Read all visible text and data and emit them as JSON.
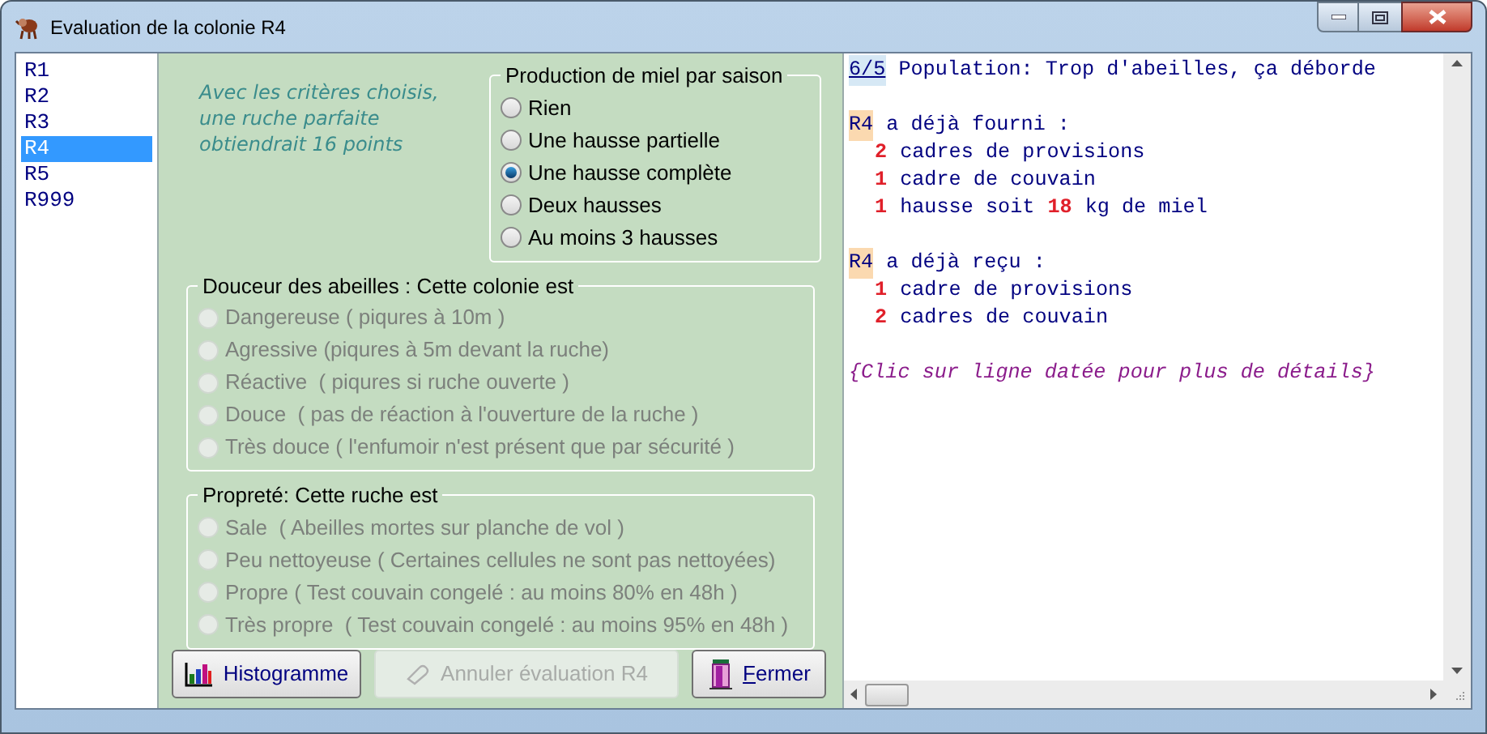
{
  "window": {
    "title": "Evaluation de la colonie R4"
  },
  "hive_list": [
    {
      "label": "R1",
      "selected": false
    },
    {
      "label": "R2",
      "selected": false
    },
    {
      "label": "R3",
      "selected": false
    },
    {
      "label": "R4",
      "selected": true
    },
    {
      "label": "R5",
      "selected": false
    },
    {
      "label": "R999",
      "selected": false
    }
  ],
  "info_text": [
    "Avec les critères choisis,",
    "une ruche parfaite",
    "obtiendrait 16 points"
  ],
  "groups": [
    {
      "title": "Production de miel par saison",
      "disabled": false,
      "options": [
        {
          "label": "Rien",
          "selected": false
        },
        {
          "label": "Une hausse partielle",
          "selected": false
        },
        {
          "label": "Une hausse complète",
          "selected": true
        },
        {
          "label": "Deux hausses",
          "selected": false
        },
        {
          "label": "Au moins 3 hausses",
          "selected": false
        }
      ]
    },
    {
      "title": "Douceur des abeilles : Cette colonie est",
      "disabled": true,
      "options": [
        {
          "label": "Dangereuse ( piqures à 10m )",
          "selected": false
        },
        {
          "label": "Agressive (piqures à 5m devant la ruche)",
          "selected": false
        },
        {
          "label": "Réactive  ( piqures si ruche ouverte )",
          "selected": false
        },
        {
          "label": "Douce  ( pas de réaction à l'ouverture de la ruche )",
          "selected": false
        },
        {
          "label": "Très douce ( l'enfumoir n'est présent que par sécurité )",
          "selected": false
        }
      ]
    },
    {
      "title": "Propreté: Cette ruche est",
      "disabled": true,
      "options": [
        {
          "label": "Sale  ( Abeilles mortes sur planche de vol )",
          "selected": false
        },
        {
          "label": "Peu nettoyeuse ( Certaines cellules ne sont pas nettoyées)",
          "selected": false
        },
        {
          "label": "Propre ( Test couvain congelé : au moins 80% en 48h )",
          "selected": false
        },
        {
          "label": "Très propre  ( Test couvain congelé : au moins 95% en 48h )",
          "selected": false
        }
      ]
    }
  ],
  "buttons": [
    {
      "label": "Histogramme",
      "kind": "chart",
      "disabled": false,
      "mnemonic": false
    },
    {
      "label": "Annuler évaluation R4",
      "kind": "eraser",
      "disabled": true,
      "mnemonic": false
    },
    {
      "label": "Fermer",
      "kind": "exit",
      "disabled": false,
      "mnemonic": true
    }
  ],
  "log": [
    {
      "header": [
        {
          "text": "6/5",
          "kind": "score"
        },
        {
          "text": "Population: Trop d'abeilles, ça déborde",
          "kind": "plain"
        }
      ]
    },
    {
      "header": [
        {
          "text": "R4",
          "kind": "tag"
        },
        {
          "text": "a déjà fourni :",
          "kind": "plain"
        }
      ],
      "children": [
        [
          {
            "text": "2",
            "kind": "count"
          },
          {
            "text": "cadres de provisions",
            "kind": "plain"
          }
        ],
        [
          {
            "text": "1",
            "kind": "count"
          },
          {
            "text": "cadre de couvain",
            "kind": "plain"
          }
        ],
        [
          {
            "text": "1",
            "kind": "count"
          },
          {
            "text": "hausse soit",
            "kind": "plain"
          },
          {
            "text": "18",
            "kind": "count"
          },
          {
            "text": "kg de miel",
            "kind": "plain"
          }
        ]
      ]
    },
    {
      "header": [
        {
          "text": "R4",
          "kind": "tag"
        },
        {
          "text": "a déjà reçu :",
          "kind": "plain"
        }
      ],
      "children": [
        [
          {
            "text": "1",
            "kind": "count"
          },
          {
            "text": "cadre de provisions",
            "kind": "plain"
          }
        ],
        [
          {
            "text": "2",
            "kind": "count"
          },
          {
            "text": "cadres de couvain",
            "kind": "plain"
          }
        ]
      ]
    },
    {
      "header": [
        {
          "text": "{Clic sur ligne datée pour plus de détails}",
          "kind": "note"
        }
      ]
    }
  ]
}
